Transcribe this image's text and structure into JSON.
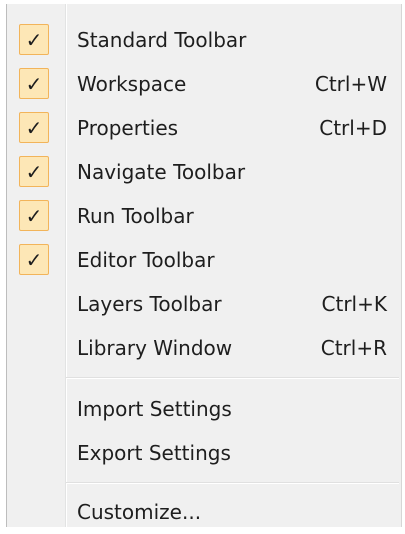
{
  "menu": {
    "check_glyph": "✓",
    "colors": {
      "background": "#f0f0f0",
      "check_fill": "#fde7b6",
      "check_border": "#f2b45a",
      "text": "#1e1e1e"
    },
    "items": [
      {
        "label": "Standard Toolbar",
        "shortcut": "",
        "checked": true
      },
      {
        "label": "Workspace",
        "shortcut": "Ctrl+W",
        "checked": true
      },
      {
        "label": "Properties",
        "shortcut": "Ctrl+D",
        "checked": true
      },
      {
        "label": "Navigate Toolbar",
        "shortcut": "",
        "checked": true
      },
      {
        "label": "Run Toolbar",
        "shortcut": "",
        "checked": true
      },
      {
        "label": "Editor Toolbar",
        "shortcut": "",
        "checked": true
      },
      {
        "label": "Layers Toolbar",
        "shortcut": "Ctrl+K",
        "checked": false
      },
      {
        "label": "Library Window",
        "shortcut": "Ctrl+R",
        "checked": false
      },
      {
        "label": "Import Settings",
        "shortcut": "",
        "checked": false
      },
      {
        "label": "Export Settings",
        "shortcut": "",
        "checked": false
      },
      {
        "label": "Customize...",
        "shortcut": "",
        "checked": false
      }
    ]
  }
}
